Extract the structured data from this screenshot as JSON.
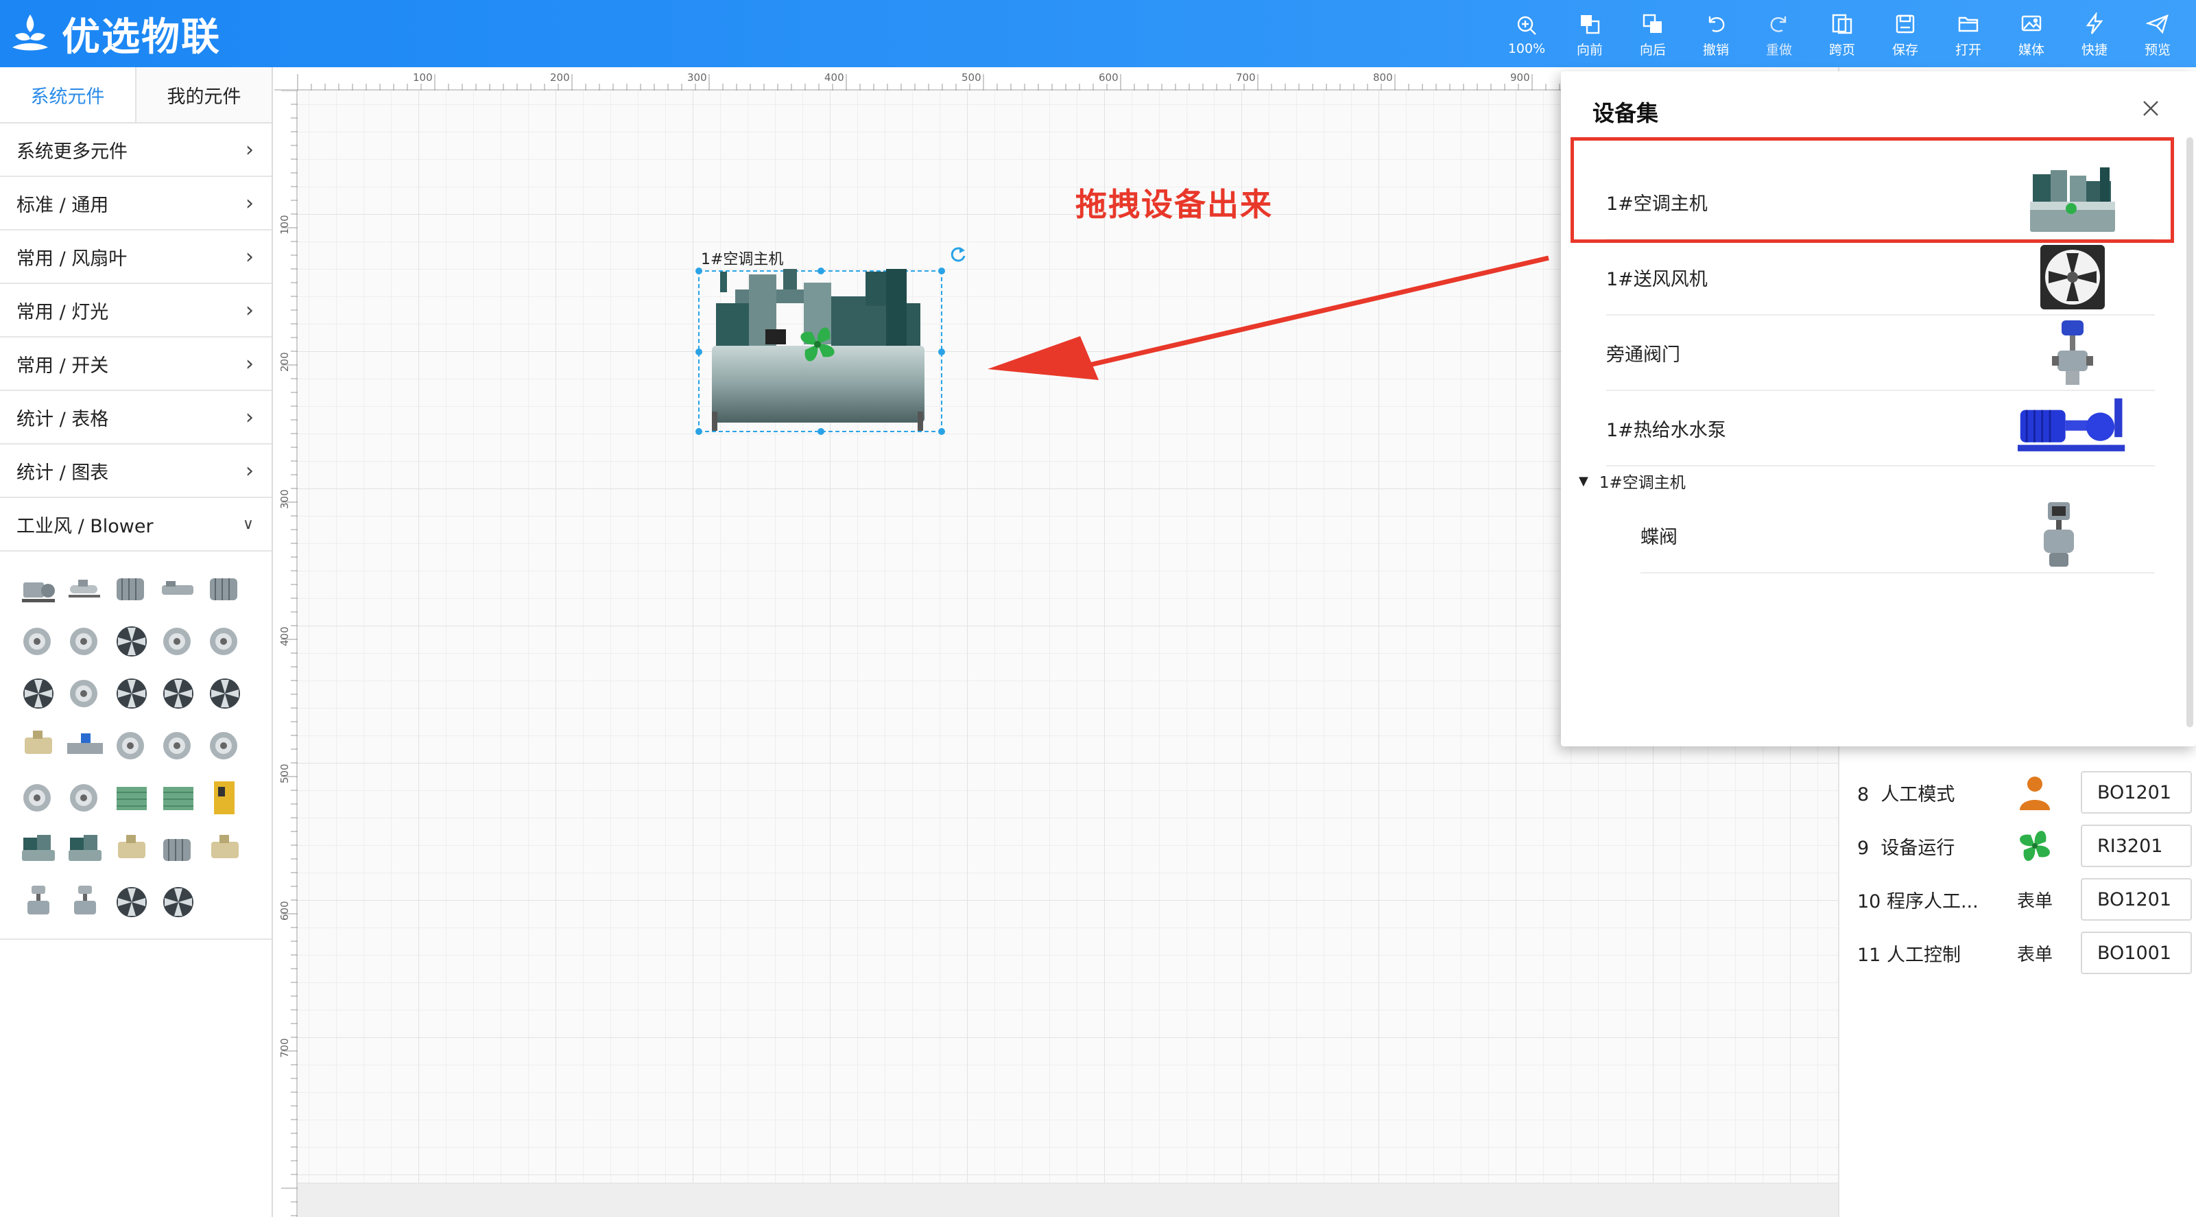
{
  "app": {
    "title": "优选物联"
  },
  "toolbar": [
    {
      "label": "100%",
      "icon": "zoom-icon"
    },
    {
      "label": "向前",
      "icon": "bring-forward-icon"
    },
    {
      "label": "向后",
      "icon": "send-backward-icon"
    },
    {
      "label": "撤销",
      "icon": "undo-icon"
    },
    {
      "label": "重做",
      "icon": "redo-icon"
    },
    {
      "label": "跨页",
      "icon": "cross-page-icon"
    },
    {
      "label": "保存",
      "icon": "save-icon"
    },
    {
      "label": "打开",
      "icon": "open-folder-icon"
    },
    {
      "label": "媒体",
      "icon": "media-icon"
    },
    {
      "label": "快捷",
      "icon": "lightning-icon"
    },
    {
      "label": "预览",
      "icon": "send-icon"
    }
  ],
  "left_panel": {
    "tabs": [
      "系统元件",
      "我的元件"
    ],
    "categories": [
      {
        "label": "系统更多元件",
        "expanded": false
      },
      {
        "label": "标准 / 通用",
        "expanded": false
      },
      {
        "label": "常用 / 风扇叶",
        "expanded": false
      },
      {
        "label": "常用 / 灯光",
        "expanded": false
      },
      {
        "label": "常用 / 开关",
        "expanded": false
      },
      {
        "label": "统计 / 表格",
        "expanded": false
      },
      {
        "label": "统计 / 图表",
        "expanded": false
      },
      {
        "label": "工业风 / Blower",
        "expanded": true
      }
    ],
    "component_icons": [
      "pump-icon",
      "compressor-icon",
      "motor-icon",
      "motor-long-icon",
      "motor-icon",
      "blower-icon",
      "blower-icon",
      "fan-icon",
      "blower-icon",
      "blower-icon",
      "fan-icon",
      "blower-icon",
      "fan-icon",
      "fan-icon",
      "fan-icon",
      "tank-icon",
      "pipe-icon",
      "blower-icon",
      "blower-icon",
      "blower-icon",
      "blower-icon",
      "blower-icon",
      "box-icon",
      "box-icon",
      "cabinet-icon",
      "chiller-icon",
      "chiller-icon",
      "tank-icon",
      "motor-icon",
      "tank-icon",
      "valve-icon",
      "valve-icon",
      "fan-icon",
      "fan-icon"
    ]
  },
  "canvas": {
    "ruler_ticks": [
      "100",
      "200",
      "300",
      "400",
      "500",
      "600",
      "700",
      "800",
      "900"
    ],
    "ruler_left_ticks": [
      "100",
      "200",
      "300",
      "400",
      "500",
      "600",
      "700"
    ],
    "device": {
      "label": "1#空调主机",
      "icon": "chiller-icon"
    },
    "annotation": "拖拽设备出来"
  },
  "right_panel": {
    "rows": [
      {
        "num": "8",
        "name": "人工模式",
        "icon": "person-icon",
        "value": "BO1201"
      },
      {
        "num": "9",
        "name": "设备运行",
        "icon": "fan-icon",
        "value": "RI3201"
      },
      {
        "num": "10",
        "name": "程序人工...",
        "icon_text": "表单",
        "value": "BO1201"
      },
      {
        "num": "11",
        "name": "人工控制",
        "icon_text": "表单",
        "value": "BO1001"
      }
    ]
  },
  "modal": {
    "title": "设备集",
    "items": [
      {
        "label": "1#空调主机",
        "icon": "chiller-icon",
        "highlighted": true
      },
      {
        "label": "1#送风风机",
        "icon": "fan-icon"
      },
      {
        "label": "旁通阀门",
        "icon": "valve-icon"
      },
      {
        "label": "1#热给水水泵",
        "icon": "pump-icon"
      }
    ],
    "group": {
      "label": "1#空调主机",
      "children": [
        {
          "label": "蝶阀",
          "icon": "butterfly-valve-icon"
        }
      ]
    }
  }
}
